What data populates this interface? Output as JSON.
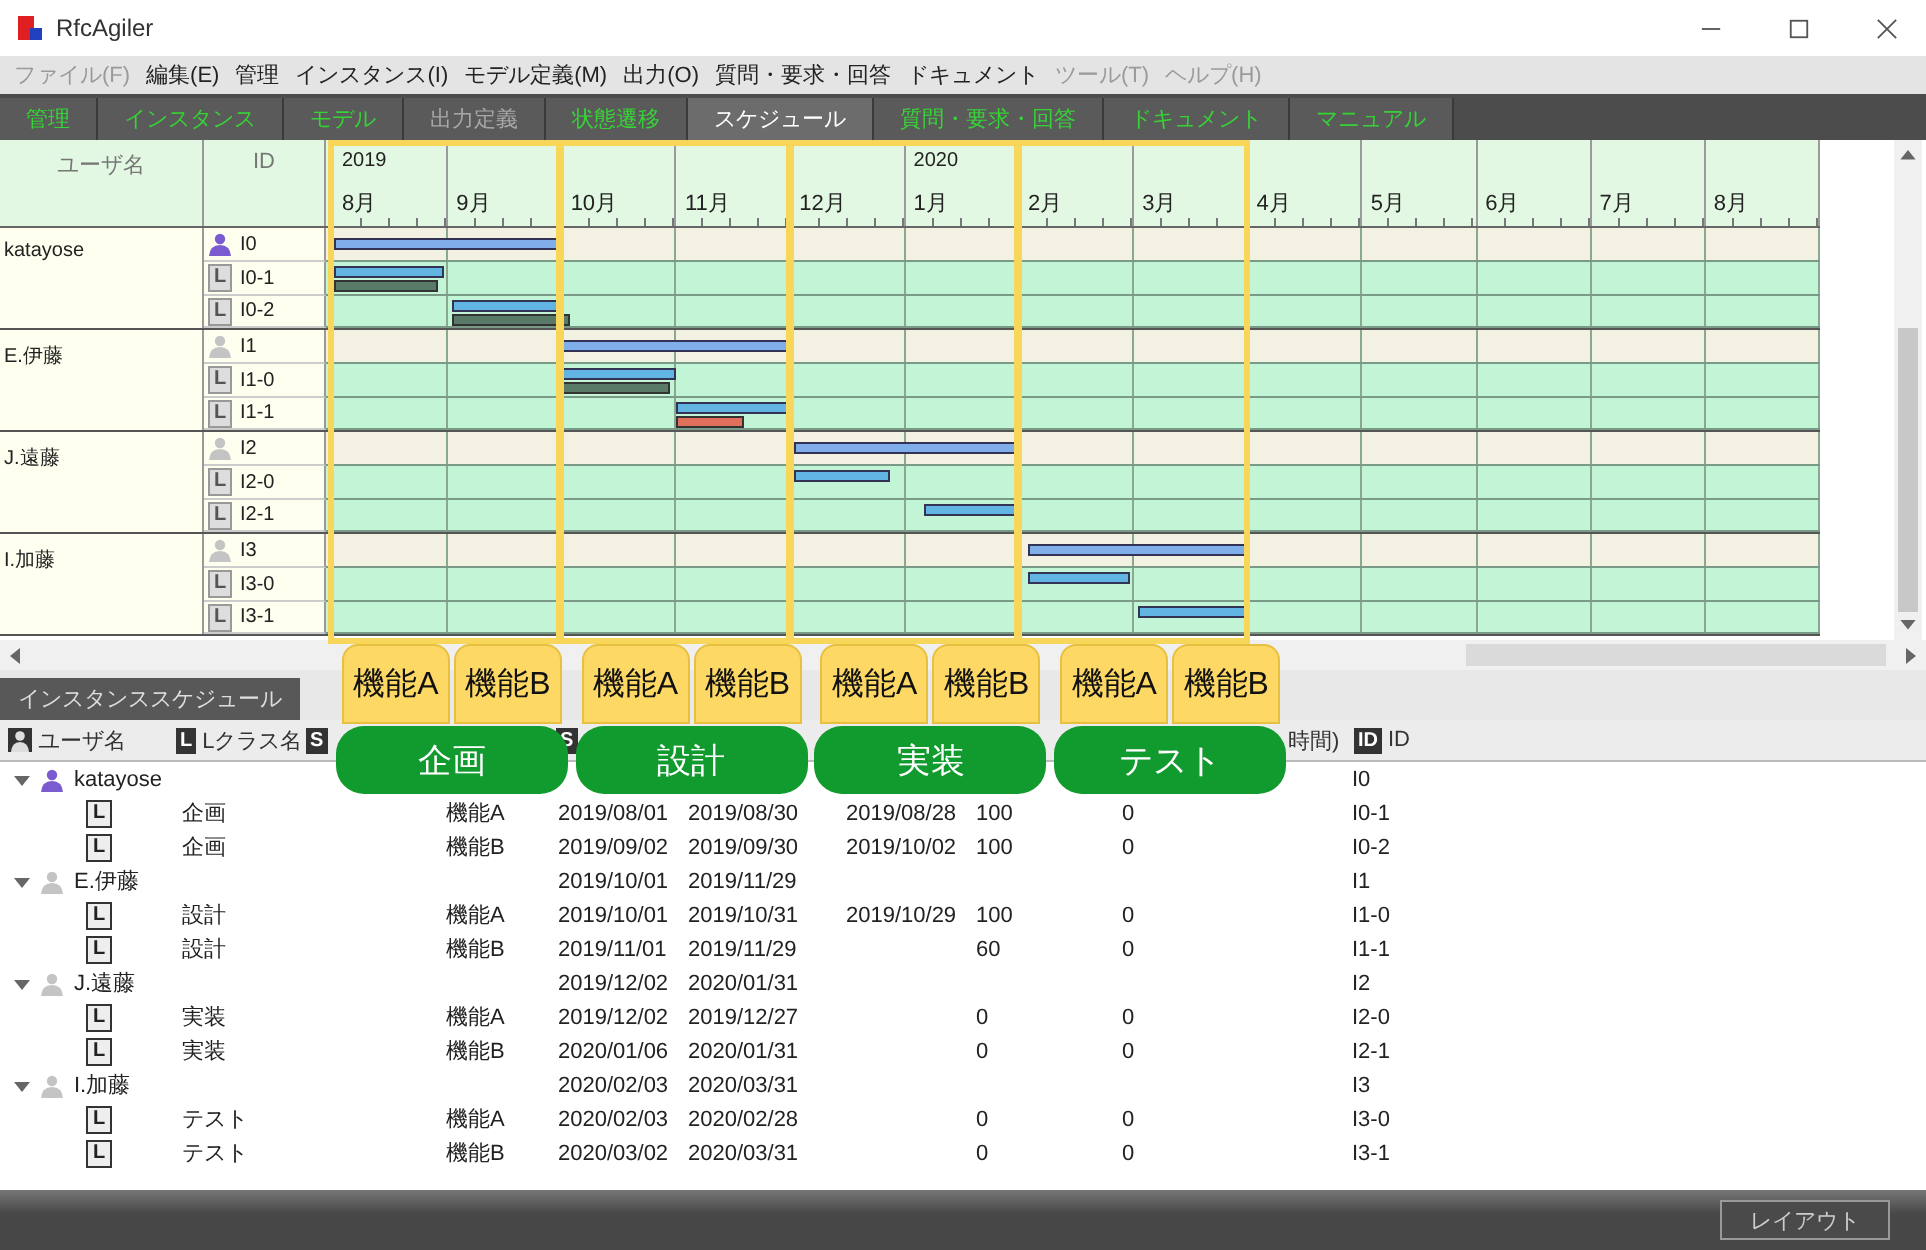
{
  "window": {
    "title": "RfcAgiler"
  },
  "menu": [
    {
      "label": "ファイル(F)",
      "disabled": true
    },
    {
      "label": "編集(E)",
      "disabled": false
    },
    {
      "label": "管理",
      "disabled": false
    },
    {
      "label": "インスタンス(I)",
      "disabled": false
    },
    {
      "label": "モデル定義(M)",
      "disabled": false
    },
    {
      "label": "出力(O)",
      "disabled": false
    },
    {
      "label": "質問・要求・回答",
      "disabled": false
    },
    {
      "label": "ドキュメント",
      "disabled": false
    },
    {
      "label": "ツール(T)",
      "disabled": true
    },
    {
      "label": "ヘルプ(H)",
      "disabled": true
    }
  ],
  "tabs": [
    {
      "label": "管理",
      "selected": false,
      "disabled": false
    },
    {
      "label": "インスタンス",
      "selected": false,
      "disabled": false
    },
    {
      "label": "モデル",
      "selected": false,
      "disabled": false
    },
    {
      "label": "出力定義",
      "selected": false,
      "disabled": true
    },
    {
      "label": "状態遷移",
      "selected": false,
      "disabled": false
    },
    {
      "label": "スケジュール",
      "selected": true,
      "disabled": false
    },
    {
      "label": "質問・要求・回答",
      "selected": false,
      "disabled": false
    },
    {
      "label": "ドキュメント",
      "selected": false,
      "disabled": false
    },
    {
      "label": "マニュアル",
      "selected": false,
      "disabled": false
    }
  ],
  "gantt": {
    "columns": [
      "ユーザ名",
      "ID"
    ],
    "months": [
      {
        "label": "8月",
        "year": "2019"
      },
      {
        "label": "9月"
      },
      {
        "label": "10月"
      },
      {
        "label": "11月"
      },
      {
        "label": "12月"
      },
      {
        "label": "1月",
        "year": "2020"
      },
      {
        "label": "2月"
      },
      {
        "label": "3月"
      },
      {
        "label": "4月"
      },
      {
        "label": "5月"
      },
      {
        "label": "6月"
      },
      {
        "label": "7月"
      },
      {
        "label": "8月"
      }
    ],
    "users": [
      {
        "name": "katayose",
        "highlighted": true,
        "rows": [
          {
            "kind": "user",
            "id": "I0"
          },
          {
            "kind": "class",
            "icon_text": "L",
            "id": "I0-1"
          },
          {
            "kind": "class",
            "icon_text": "L",
            "id": "I0-2"
          }
        ]
      },
      {
        "name": "E.伊藤",
        "highlighted": false,
        "rows": [
          {
            "kind": "user",
            "id": "I1"
          },
          {
            "kind": "class",
            "icon_text": "L",
            "id": "I1-0"
          },
          {
            "kind": "class",
            "icon_text": "L",
            "id": "I1-1"
          }
        ]
      },
      {
        "name": "J.遠藤",
        "highlighted": false,
        "rows": [
          {
            "kind": "user",
            "id": "I2"
          },
          {
            "kind": "class",
            "icon_text": "L",
            "id": "I2-0"
          },
          {
            "kind": "class",
            "icon_text": "L",
            "id": "I2-1"
          }
        ]
      },
      {
        "name": "I.加藤",
        "highlighted": false,
        "rows": [
          {
            "kind": "user",
            "id": "I3"
          },
          {
            "kind": "class",
            "icon_text": "L",
            "id": "I3-0"
          },
          {
            "kind": "class",
            "icon_text": "L",
            "id": "I3-1"
          }
        ]
      }
    ]
  },
  "instance_panel": {
    "tab": "インスタンススケジュール",
    "header": [
      {
        "kind": "user",
        "label": "ユーザ名"
      },
      {
        "kind": "letter",
        "icon_text": "L",
        "label": "Lクラス名"
      },
      {
        "kind": "letter",
        "icon_text": "S"
      },
      {
        "kind": "letter",
        "icon_text": "S"
      },
      {
        "kind": "text",
        "label": "時間)"
      },
      {
        "kind": "letter",
        "icon_text": "ID",
        "label": "ID"
      }
    ],
    "tree": [
      {
        "name": "katayose",
        "highlighted": true,
        "expanded": true,
        "id": "I0",
        "children": [
          {
            "icon_text": "L",
            "class": "企画",
            "function": "機能A",
            "start": "2019/08/01",
            "end": "2019/08/30",
            "actual_end": "2019/08/28",
            "progress": "100",
            "column_8": "0",
            "id": "I0-1"
          },
          {
            "icon_text": "L",
            "class": "企画",
            "function": "機能B",
            "start": "2019/09/02",
            "end": "2019/09/30",
            "actual_end": "2019/10/02",
            "progress": "100",
            "column_8": "0",
            "id": "I0-2"
          }
        ]
      },
      {
        "name": "E.伊藤",
        "highlighted": false,
        "expanded": true,
        "start": "2019/10/01",
        "end": "2019/11/29",
        "id": "I1",
        "children": [
          {
            "icon_text": "L",
            "class": "設計",
            "function": "機能A",
            "start": "2019/10/01",
            "end": "2019/10/31",
            "actual_end": "2019/10/29",
            "progress": "100",
            "column_8": "0",
            "id": "I1-0"
          },
          {
            "icon_text": "L",
            "class": "設計",
            "function": "機能B",
            "start": "2019/11/01",
            "end": "2019/11/29",
            "progress": "60",
            "column_8": "0",
            "id": "I1-1"
          }
        ]
      },
      {
        "name": "J.遠藤",
        "highlighted": false,
        "expanded": true,
        "start": "2019/12/02",
        "end": "2020/01/31",
        "id": "I2",
        "children": [
          {
            "icon_text": "L",
            "class": "実装",
            "function": "機能A",
            "start": "2019/12/02",
            "end": "2019/12/27",
            "progress": "0",
            "column_8": "0",
            "id": "I2-0"
          },
          {
            "icon_text": "L",
            "class": "実装",
            "function": "機能B",
            "start": "2020/01/06",
            "end": "2020/01/31",
            "progress": "0",
            "column_8": "0",
            "id": "I2-1"
          }
        ]
      },
      {
        "name": "I.加藤",
        "highlighted": false,
        "expanded": true,
        "start": "2020/02/03",
        "end": "2020/03/31",
        "id": "I3",
        "children": [
          {
            "icon_text": "L",
            "class": "テスト",
            "function": "機能A",
            "start": "2020/02/03",
            "end": "2020/02/28",
            "progress": "0",
            "column_8": "0",
            "id": "I3-0"
          },
          {
            "icon_text": "L",
            "class": "テスト",
            "function": "機能B",
            "start": "2020/03/02",
            "end": "2020/03/31",
            "progress": "0",
            "column_8": "0",
            "id": "I3-1"
          }
        ]
      }
    ]
  },
  "annotations": [
    {
      "label": "企画",
      "features": [
        "機能A",
        "機能B"
      ]
    },
    {
      "label": "設計",
      "features": [
        "機能A",
        "機能B"
      ]
    },
    {
      "label": "実装",
      "features": [
        "機能A",
        "機能B"
      ]
    },
    {
      "label": "テスト",
      "features": [
        "機能A",
        "機能B"
      ]
    }
  ],
  "bottom_bar": {
    "button": "レイアウト"
  }
}
